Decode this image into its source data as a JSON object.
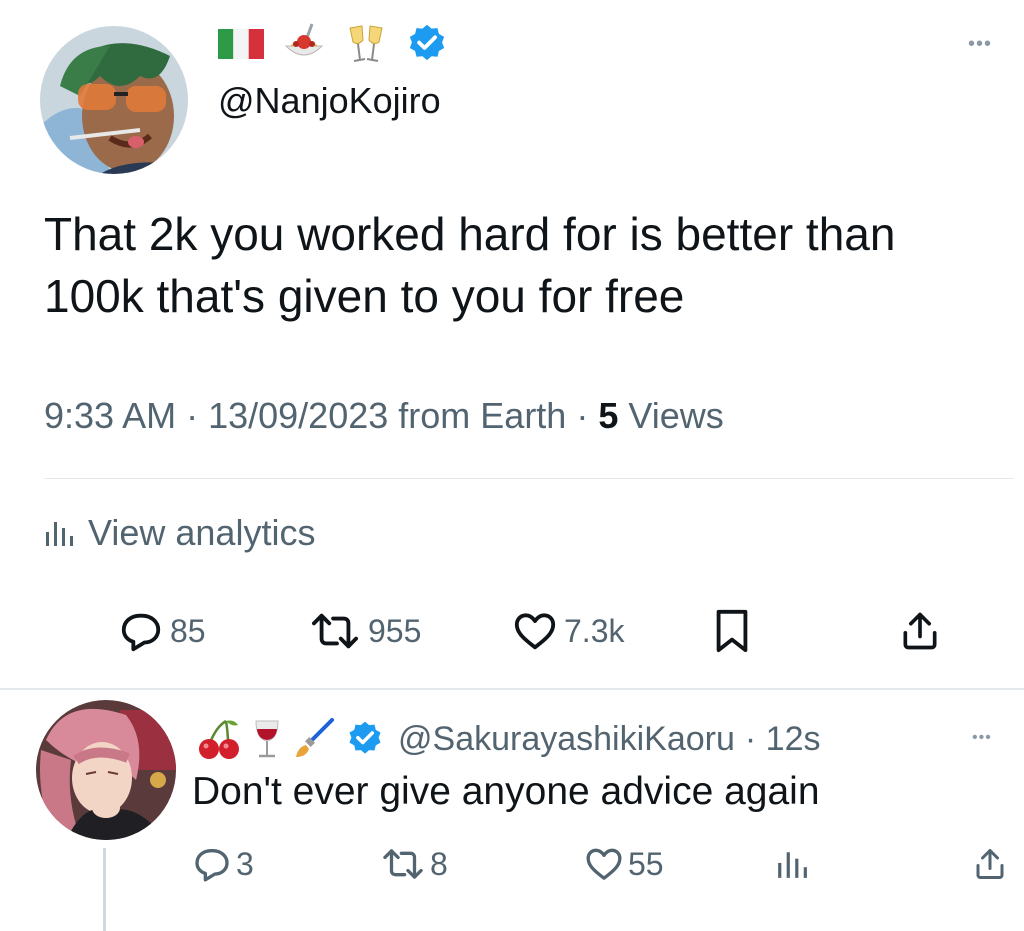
{
  "main_tweet": {
    "name_emojis": [
      "italy-flag-icon",
      "spaghetti-icon",
      "clinking-glasses-icon"
    ],
    "verified": true,
    "handle": "@NanjoKojiro",
    "more_label": "•••",
    "text": "That 2k you worked hard for is better than 100k that's given to you for free",
    "meta": {
      "time": "9:33 AM",
      "sep1": " · ",
      "date": "13/09/2023",
      "source": " from Earth",
      "sep2": " · ",
      "views_count": "5",
      "views_label": " Views"
    },
    "analytics_label": "View analytics",
    "actions": {
      "replies": "85",
      "retweets": "955",
      "likes": "7.3k"
    }
  },
  "reply_tweet": {
    "name_emojis": [
      "cherries-icon",
      "wine-glass-icon",
      "paintbrush-icon"
    ],
    "verified": true,
    "handle": "@SakurayashikiKaoru",
    "time": "· 12s",
    "more_label": "•••",
    "text": "Don't ever give anyone advice again",
    "actions": {
      "replies": "3",
      "retweets": "8",
      "likes": "55"
    }
  },
  "colors": {
    "text_primary": "#0f1419",
    "text_secondary": "#536471",
    "verified_blue": "#1d9bf0",
    "divider": "#e6e9eb"
  }
}
